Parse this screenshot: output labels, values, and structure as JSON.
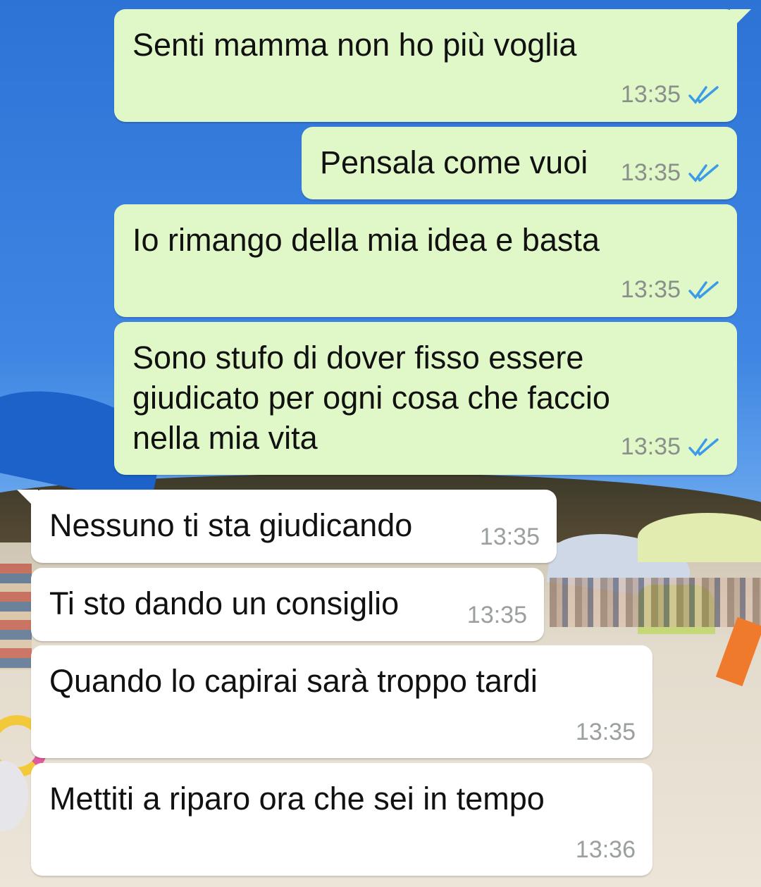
{
  "messages": [
    {
      "text": "Senti mamma non ho più voglia",
      "time": "13:35",
      "status": "read-ticks-icon"
    },
    {
      "text": "Pensala come vuoi",
      "time": "13:35",
      "status": "read-ticks-icon"
    },
    {
      "text": "Io rimango della mia idea e basta",
      "time": "13:35",
      "status": "read-ticks-icon"
    },
    {
      "text": "Sono stufo di dover fisso essere\ngiudicato per ogni cosa che faccio\nnella mia vita",
      "time": "13:35",
      "status": "read-ticks-icon"
    },
    {
      "text": "Nessuno ti sta giudicando",
      "time": "13:35"
    },
    {
      "text": "Ti sto dando un consiglio",
      "time": "13:35"
    },
    {
      "text": "Quando lo capirai sarà troppo tardi",
      "time": "13:35"
    },
    {
      "text": "Mettiti a riparo ora che sei in tempo",
      "time": "13:36"
    }
  ],
  "colors": {
    "outgoing_bubble": "#e0f8c8",
    "incoming_bubble": "#ffffff",
    "read_ticks": "#3b9be8"
  }
}
